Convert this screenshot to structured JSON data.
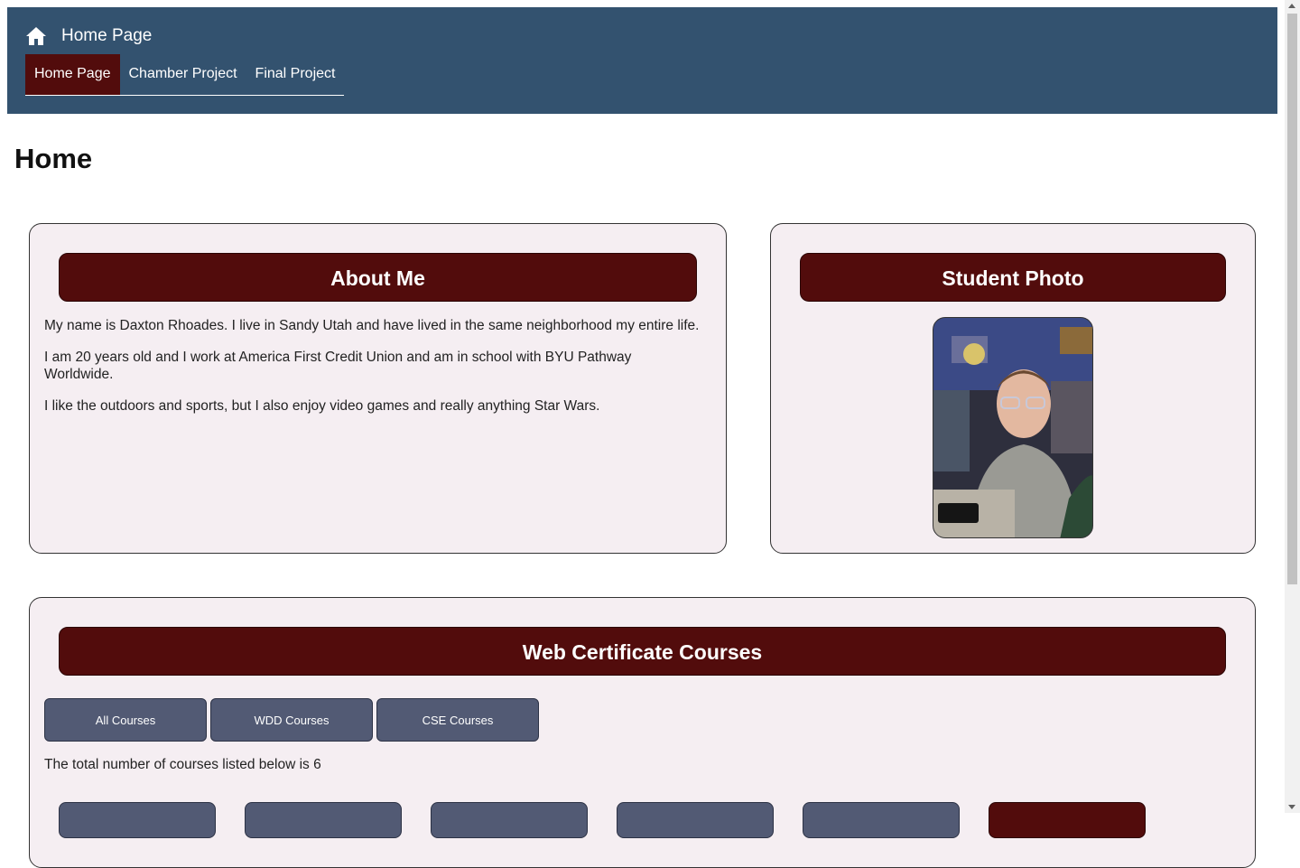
{
  "header": {
    "brand_text": "Home Page",
    "nav": [
      {
        "label": "Home Page",
        "active": true
      },
      {
        "label": "Chamber Project",
        "active": false
      },
      {
        "label": "Final Project",
        "active": false
      }
    ]
  },
  "main": {
    "title": "Home",
    "about": {
      "heading": "About Me",
      "paragraphs": [
        "My name is Daxton Rhoades. I live in Sandy Utah and have lived in the same neighborhood my entire life.",
        "I am 20 years old and I work at America First Credit Union and am in school with BYU Pathway Worldwide.",
        "I like the outdoors and sports, but I also enjoy video games and really anything Star Wars."
      ]
    },
    "photo": {
      "heading": "Student Photo"
    },
    "courses": {
      "heading": "Web Certificate Courses",
      "filters": [
        "All Courses",
        "WDD Courses",
        "CSE Courses"
      ],
      "total_text": "The total number of courses listed below is 6"
    }
  },
  "colors": {
    "header_bg": "#33526f",
    "accent": "#520c0c",
    "button_bg": "#525a74",
    "card_bg": "#f5eef2"
  },
  "icons": {
    "brand": "home-icon"
  }
}
